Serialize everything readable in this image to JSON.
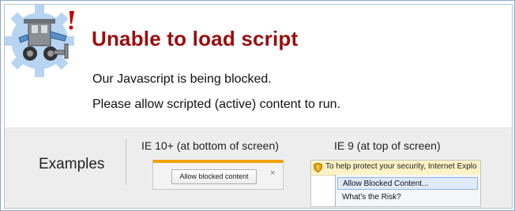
{
  "title": "Unable to load script",
  "message_line1": "Our Javascript is being blocked.",
  "message_line2": "Please allow scripted (active) content to run.",
  "examples": {
    "label": "Examples",
    "ie10": {
      "caption": "IE 10+ (at bottom of screen)",
      "button_label": "Allow blocked content",
      "close_glyph": "×"
    },
    "ie9": {
      "caption": "IE 9 (at top of screen)",
      "info_text": "To help protect your security, Internet Explo",
      "menu_item_allow": "Allow Blocked Content...",
      "menu_item_risk": "What's the Risk?"
    }
  },
  "colors": {
    "title": "#9b0d0d",
    "gear": "#b7d5f1",
    "exclaim": "#c00000",
    "ie10_accent": "#f0a30a",
    "band": "#ededed"
  },
  "icons": {
    "logo": "robot-gear-logo-icon",
    "warning": "shield-warning-icon"
  }
}
